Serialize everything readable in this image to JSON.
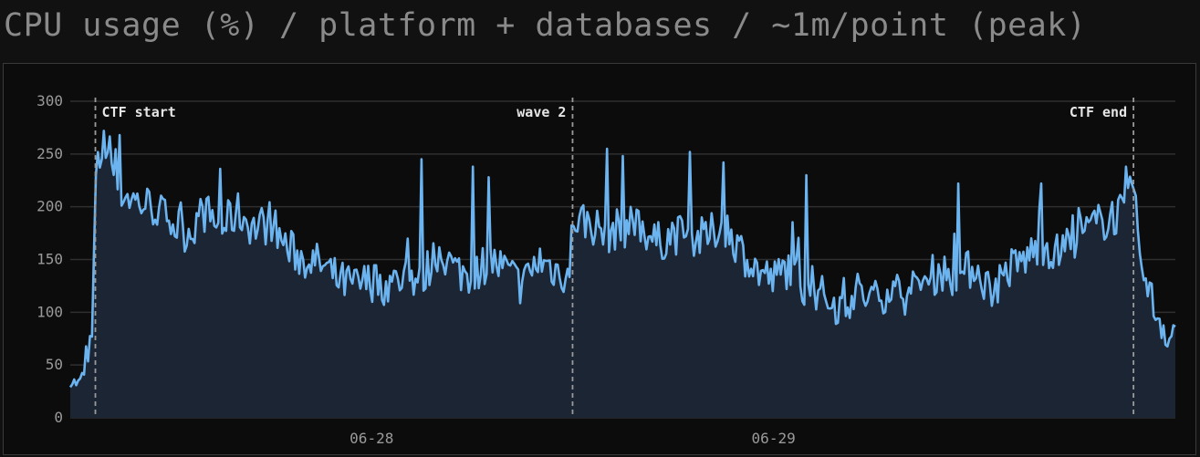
{
  "title": "CPU usage (%) / platform + databases / ~1m/point (peak)",
  "colors": {
    "line": "#6cb4f0",
    "fill": "#1b2533",
    "grid": "#2f2f2f",
    "marker": "#9a9a9a"
  },
  "chart_data": {
    "type": "area",
    "title": "CPU usage (%) / platform + databases / ~1m/point (peak)",
    "ylim": [
      0,
      300
    ],
    "yticks": [
      0,
      50,
      100,
      150,
      200,
      250,
      300
    ],
    "xlim": [
      "06-27 06:00",
      "06-30 00:00"
    ],
    "xticks": [
      {
        "label": "06-28",
        "x": "06-28 00:00"
      },
      {
        "label": "06-29",
        "x": "06-29 00:00"
      }
    ],
    "grid": true,
    "annotations": [
      {
        "label": "CTF start",
        "x": "06-27 07:30"
      },
      {
        "label": "wave 2",
        "x": "06-28 12:00"
      },
      {
        "label": "CTF end",
        "x": "06-29 21:30"
      }
    ],
    "series": [
      {
        "x": [
          "06-27 06:00",
          "06-27 06:30",
          "06-27 07:00",
          "06-27 07:20",
          "06-27 07:30",
          "06-27 08:00",
          "06-27 09:00",
          "06-27 10:00",
          "06-27 11:00",
          "06-27 12:00",
          "06-27 13:00",
          "06-27 14:00",
          "06-27 15:00",
          "06-27 16:00",
          "06-27 17:00",
          "06-27 18:00",
          "06-27 19:00",
          "06-27 20:00",
          "06-27 21:00",
          "06-27 22:00",
          "06-27 23:00",
          "06-28 00:00",
          "06-28 01:00",
          "06-28 02:00",
          "06-28 03:00",
          "06-28 04:00",
          "06-28 05:00",
          "06-28 06:00",
          "06-28 07:00",
          "06-28 08:00",
          "06-28 09:00",
          "06-28 10:00",
          "06-28 11:00",
          "06-28 11:50",
          "06-28 12:00",
          "06-28 13:00",
          "06-28 14:00",
          "06-28 15:00",
          "06-28 16:00",
          "06-28 17:00",
          "06-28 18:00",
          "06-28 19:00",
          "06-28 20:00",
          "06-28 21:00",
          "06-28 22:00",
          "06-28 23:00",
          "06-29 00:00",
          "06-29 01:00",
          "06-29 02:00",
          "06-29 03:00",
          "06-29 04:00",
          "06-29 05:00",
          "06-29 06:00",
          "06-29 07:00",
          "06-29 08:00",
          "06-29 09:00",
          "06-29 10:00",
          "06-29 11:00",
          "06-29 12:00",
          "06-29 13:00",
          "06-29 14:00",
          "06-29 15:00",
          "06-29 16:00",
          "06-29 17:00",
          "06-29 18:00",
          "06-29 19:00",
          "06-29 20:00",
          "06-29 21:00",
          "06-29 21:30",
          "06-29 22:00",
          "06-29 23:00",
          "06-30 00:00"
        ],
        "y": [
          35,
          32,
          48,
          80,
          225,
          260,
          215,
          205,
          200,
          185,
          175,
          195,
          180,
          195,
          180,
          185,
          160,
          150,
          145,
          130,
          125,
          130,
          125,
          135,
          130,
          160,
          140,
          135,
          150,
          140,
          125,
          150,
          140,
          135,
          190,
          185,
          175,
          180,
          185,
          165,
          175,
          170,
          170,
          185,
          160,
          140,
          130,
          145,
          120,
          115,
          105,
          120,
          110,
          125,
          115,
          130,
          140,
          130,
          145,
          120,
          140,
          150,
          165,
          155,
          170,
          180,
          190,
          195,
          220,
          135,
          95,
          70
        ],
        "spikes": [
          {
            "x": "06-27 08:00",
            "y": 272
          },
          {
            "x": "06-27 09:00",
            "y": 268
          },
          {
            "x": "06-27 15:00",
            "y": 236
          },
          {
            "x": "06-28 03:00",
            "y": 245
          },
          {
            "x": "06-28 06:00",
            "y": 238
          },
          {
            "x": "06-28 07:00",
            "y": 228
          },
          {
            "x": "06-28 14:00",
            "y": 255
          },
          {
            "x": "06-28 15:00",
            "y": 248
          },
          {
            "x": "06-28 19:00",
            "y": 252
          },
          {
            "x": "06-28 21:00",
            "y": 242
          },
          {
            "x": "06-29 02:00",
            "y": 230
          },
          {
            "x": "06-29 11:00",
            "y": 222
          },
          {
            "x": "06-29 16:00",
            "y": 222
          },
          {
            "x": "06-29 21:00",
            "y": 238
          }
        ]
      }
    ]
  }
}
